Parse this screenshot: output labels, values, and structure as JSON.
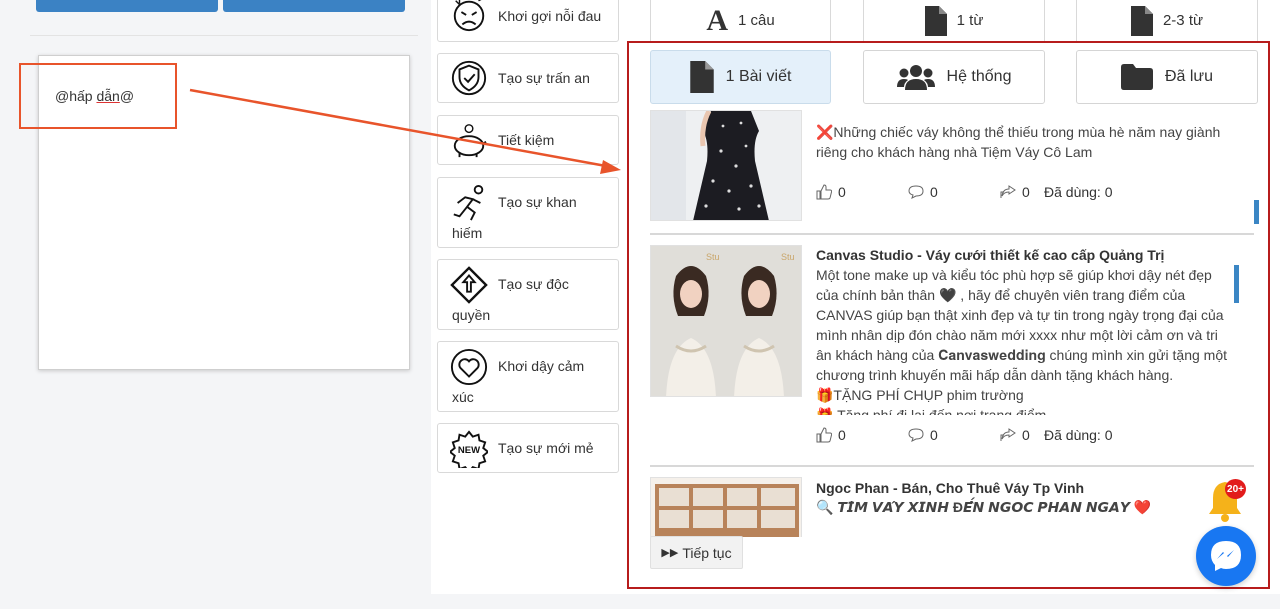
{
  "editor": {
    "text_prefix": "@hấp ",
    "text_underlined": "dẫn",
    "text_suffix": "@"
  },
  "categories": [
    {
      "icon": "angry-face-icon",
      "label": "Khơi gợi nỗi đau",
      "label2": ""
    },
    {
      "icon": "shield-check-icon",
      "label": "Tạo sự trấn an",
      "label2": ""
    },
    {
      "icon": "piggy-bank-icon",
      "label": "Tiết kiệm",
      "label2": ""
    },
    {
      "icon": "running-person-icon",
      "label": "Tạo sự khan",
      "label2": "hiếm"
    },
    {
      "icon": "exclusive-diamond-icon",
      "label": "Tạo sự độc",
      "label2": "quyền"
    },
    {
      "icon": "heart-icon",
      "label": "Khơi dậy cảm",
      "label2": "xúc"
    },
    {
      "icon": "new-badge-icon",
      "label": "Tạo sự mới mẻ",
      "label2": ""
    }
  ],
  "type_tabs": [
    {
      "icon": "letter-a-icon",
      "label": "1 câu"
    },
    {
      "icon": "document-icon",
      "label": "1 từ"
    },
    {
      "icon": "document-icon",
      "label": "2-3 từ"
    }
  ],
  "tabs": [
    {
      "icon": "document-icon",
      "label": "1 Bài viết",
      "active": true
    },
    {
      "icon": "users-icon",
      "label": "Hệ thống",
      "active": false
    },
    {
      "icon": "folder-icon",
      "label": "Đã lưu",
      "active": false
    }
  ],
  "posts": [
    {
      "title": "",
      "body": [
        "❌Những chiếc váy không thể thiếu trong mùa hè năm nay giành riêng cho khách hàng nhà Tiệm Váy Cô Lam"
      ],
      "likes": "0",
      "comments": "0",
      "shares": "0",
      "used": "Đã dùng: 0"
    },
    {
      "title": "Canvas Studio - Váy cưới thiết kế cao cấp Quảng Trị",
      "body": [
        "Một tone make up và kiểu tóc phù hợp sẽ giúp khơi dậy nét đẹp của chính bản thân 🖤 , hãy để chuyên viên trang điểm của CANVAS giúp bạn thật xinh đẹp và tự tin trong ngày trọng đại của mình nhân dịp đón chào năm mới xxxx như một lời cảm ơn và tri ân khách hàng của 𝐂𝐚𝐧𝐯𝐚𝐬𝐰𝐞𝐝𝐝𝐢𝐧𝐠 chúng mình xin gửi tặng một chương trình khuyến mãi hấp dẫn dành tặng khách hàng.",
        "🎁TẶNG PHÍ CHỤP phim trường",
        "🎁 Tặng phí đi lại đến nơi trang điểm"
      ],
      "likes": "0",
      "comments": "0",
      "shares": "0",
      "used": "Đã dùng: 0"
    },
    {
      "title": "Ngoc Phan - Bán, Cho Thuê Váy Tp Vinh",
      "body": [
        "🔍 𝙏𝙄̀𝙈 𝙑𝘼́𝙔 𝙓𝙄𝙉𝙃 Đ𝙀̂́𝙉 𝙉𝙂𝙊𝘾 𝙋𝙃𝘼𝙉 𝙉𝙂𝘼𝙔 ❤️"
      ],
      "likes": "",
      "comments": "",
      "shares": "",
      "used": ""
    }
  ],
  "continue_label": "Tiếp tục",
  "notification_badge": "20+",
  "colors": {
    "accent": "#3b82c4",
    "frame": "#b71c1c",
    "arrow": "#e8542b",
    "messenger": "#1877f2"
  }
}
